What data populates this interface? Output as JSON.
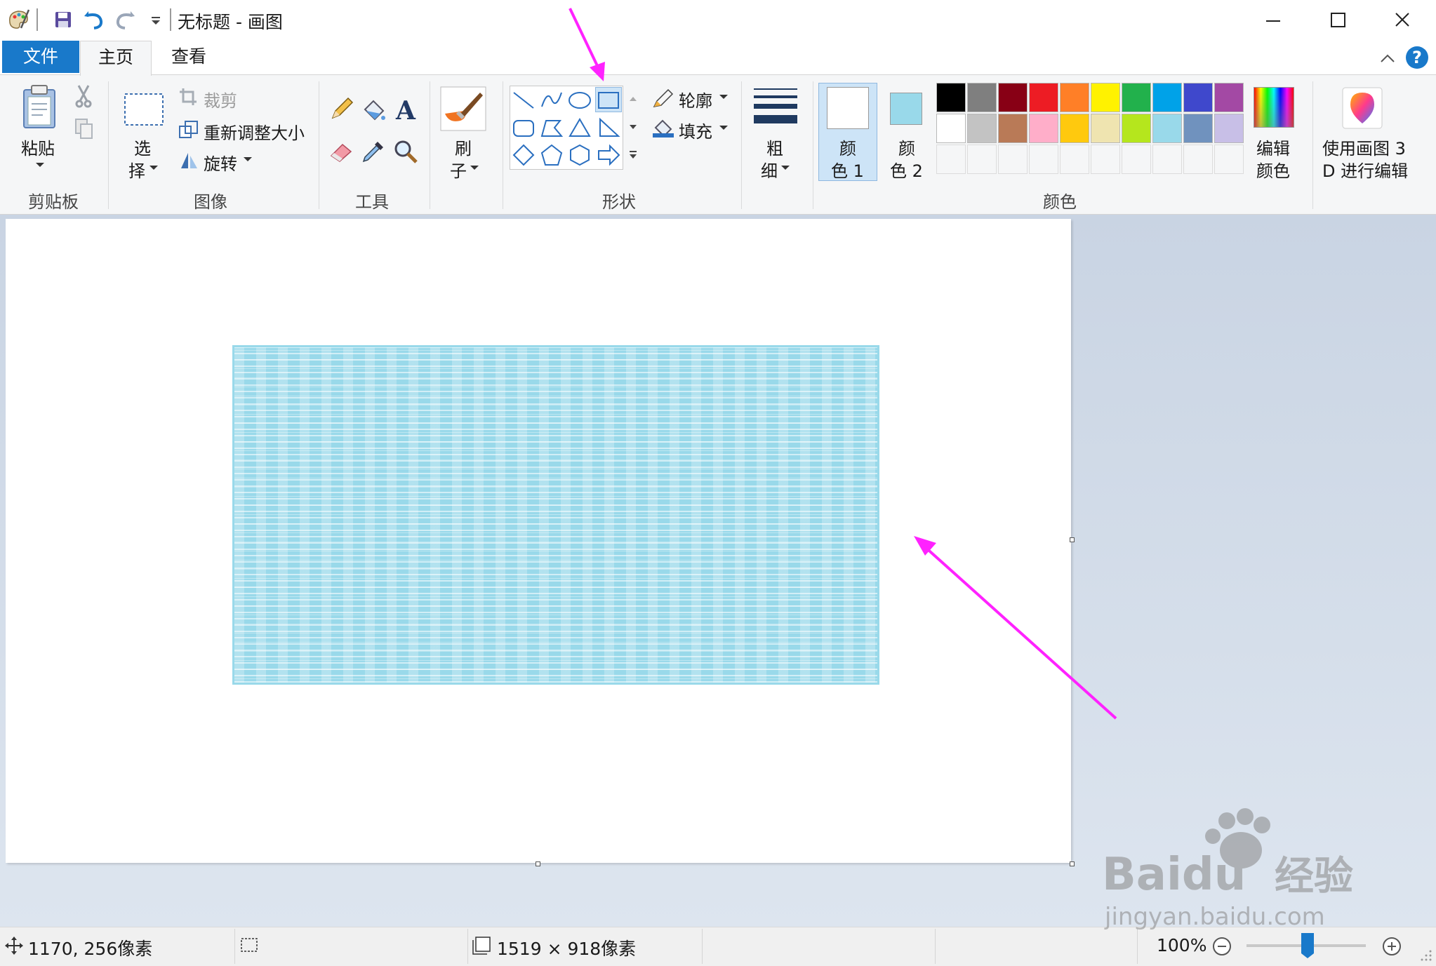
{
  "window": {
    "title": "无标题 - 画图",
    "quick_access": [
      "save-icon",
      "undo-icon",
      "redo-icon",
      "customize-dropdown-icon"
    ],
    "controls": [
      "minimize-icon",
      "maximize-icon",
      "close-icon"
    ]
  },
  "tabs": {
    "file": "文件",
    "home": "主页",
    "view": "查看",
    "active": "主页"
  },
  "ribbon": {
    "clipboard": {
      "label": "剪贴板",
      "paste": "粘贴"
    },
    "image": {
      "label": "图像",
      "select_top": "选",
      "select_bottom": "择",
      "crop": "裁剪",
      "resize": "重新调整大小",
      "rotate": "旋转"
    },
    "tools": {
      "label": "工具",
      "items": [
        "pencil-icon",
        "fill-bucket-icon",
        "text-icon",
        "eraser-icon",
        "color-picker-icon",
        "magnifier-icon"
      ]
    },
    "brushes": {
      "top": "刷",
      "bottom": "子"
    },
    "shapes": {
      "label": "形状",
      "outline": "轮廓",
      "fill": "填充",
      "selected": "rectangle",
      "items": [
        "line",
        "curve",
        "oval",
        "rectangle",
        "rounded-rectangle",
        "polygon",
        "triangle",
        "right-triangle",
        "diamond",
        "pentagon",
        "hexagon",
        "right-arrow"
      ]
    },
    "size": {
      "top": "粗",
      "bottom": "细"
    },
    "color1": {
      "top": "颜",
      "bottom": "色 1",
      "swatch": "#ffffff"
    },
    "color2": {
      "top": "颜",
      "bottom": "色 2",
      "swatch": "#99d9ea"
    },
    "colors": {
      "label": "颜色",
      "row1": [
        "#000000",
        "#7f7f7f",
        "#880015",
        "#ed1c24",
        "#ff7f27",
        "#fff200",
        "#22b14c",
        "#00a2e8",
        "#3f48cc",
        "#a349a4"
      ],
      "row2": [
        "#ffffff",
        "#c3c3c3",
        "#b97a57",
        "#ffaec9",
        "#ffc90e",
        "#efe4b0",
        "#b5e61d",
        "#99d9ea",
        "#7092be",
        "#c8bfe7"
      ],
      "edit_top": "编辑",
      "edit_bottom": "颜色"
    },
    "paint3d": {
      "top": "使用画图 3",
      "bottom": "D 进行编辑"
    }
  },
  "canvas": {
    "background": "#ffffff",
    "shape_fill": "#99d9ea"
  },
  "status": {
    "cursor_position": "1170, 256像素",
    "canvas_size": "1519 × 918像素",
    "zoom": "100%",
    "zoom_percent": 100
  },
  "annotations": {
    "arrow_color": "#ff22ff"
  },
  "watermark": {
    "brand": "Baidu",
    "cn": "经验",
    "url": "jingyan.baidu.com"
  }
}
